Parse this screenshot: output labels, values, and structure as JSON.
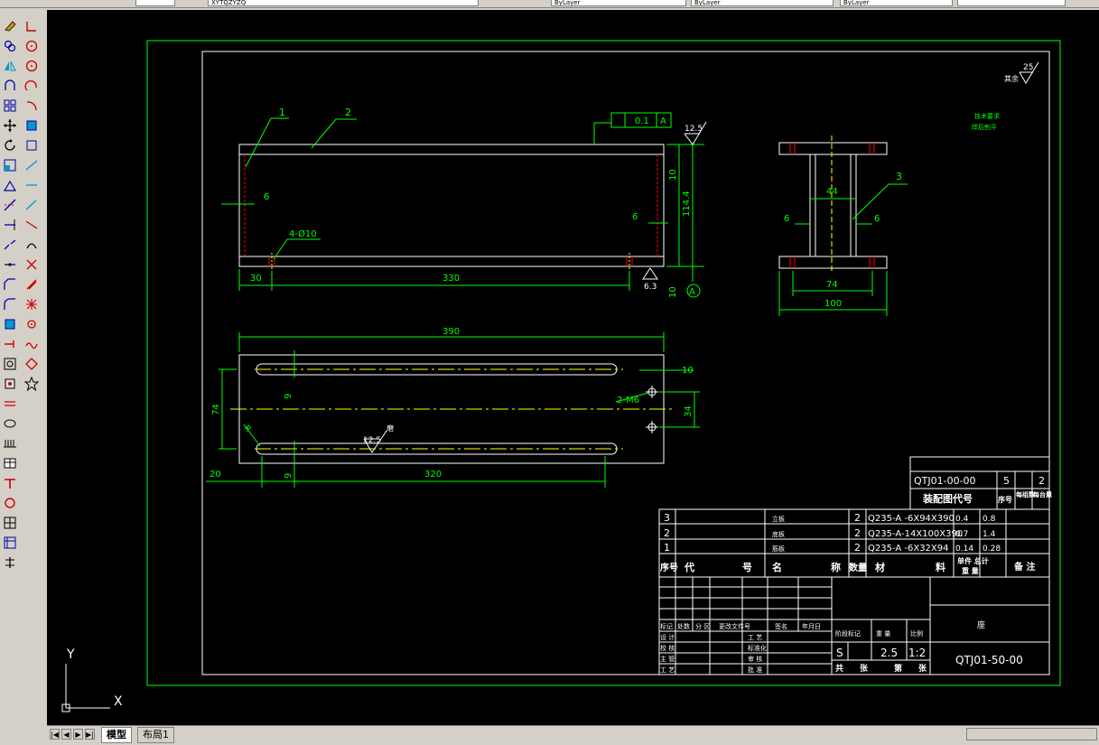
{
  "app": {
    "topbar": {
      "field1": "...",
      "field2": "XYTQZYZQ",
      "field3": "ByLayer",
      "field4": "ByLayer",
      "field5": "ByLayer"
    }
  },
  "tabs": [
    {
      "label": "模型"
    },
    {
      "label": "布局1"
    }
  ],
  "ucs": {
    "x_label": "X",
    "y_label": "Y"
  },
  "drawing": {
    "front_view": {
      "balloon_1": "1",
      "balloon_2": "2",
      "dim_6_left": "6",
      "dim_6_right": "6",
      "hole_note": "4-Ø10",
      "dim_30": "30",
      "dim_330": "330",
      "dim_10_top": "10",
      "dim_114": "114.4",
      "dim_10_bottom": "10",
      "tol_value": "0.1",
      "tol_datum": "A",
      "rough_top": "12.5",
      "rough_bottom": "6.3",
      "datum_label": "A"
    },
    "side_view": {
      "balloon_3": "3",
      "dim_44": "44",
      "dim_6_left": "6",
      "dim_6_right": "6",
      "dim_74": "74",
      "dim_100": "100"
    },
    "top_view": {
      "dim_390": "390",
      "dim_10": "10",
      "dim_74": "74",
      "thread_note": "2-M6",
      "dim_34": "34",
      "dim_9_top": "9",
      "dim_9_bottom": "9",
      "rough": "12.5",
      "rough_label": "磨",
      "radius_label": "R",
      "dim_20": "20",
      "dim_320": "320"
    },
    "notes": {
      "corner_rough": "25",
      "corner_rough_label": "其余",
      "tech_req_1": "技术要求",
      "tech_req_2": "焊后刨平"
    },
    "assembly_block": {
      "drawing_no": "QTJ01-00-00",
      "qty_a": "5",
      "qty_b": "2",
      "title": "装配图代号",
      "h_seq": "序号",
      "h_per": "每组数",
      "h_total": "每台量"
    },
    "bom": {
      "rows": [
        {
          "seq": "3",
          "code": "",
          "name": "立板",
          "qty": "2",
          "material": "Q235-A -6X94X390",
          "unit": "0.4",
          "total": "0.8",
          "note": ""
        },
        {
          "seq": "2",
          "code": "",
          "name": "底板",
          "qty": "2",
          "material": "Q235-A-14X100X390",
          "unit": "0.7",
          "total": "1.4",
          "note": ""
        },
        {
          "seq": "1",
          "code": "",
          "name": "筋板",
          "qty": "2",
          "material": "Q235-A -6X32X94",
          "unit": "0.14",
          "total": "0.28",
          "note": ""
        }
      ],
      "header": {
        "seq": "序号",
        "code": "代",
        "code2": "号",
        "name": "名",
        "name2": "称",
        "qty": "数量",
        "material": "材",
        "material2": "料",
        "weight_top": "单件 总计",
        "weight_bot": "重    量",
        "note": "备 注"
      }
    },
    "title_block": {
      "r1": "标记",
      "r2": "处数",
      "r3": "分 区",
      "r4": "更改文件号",
      "r5": "签名",
      "r6": "年月日",
      "design": "设 计",
      "check": "校 核",
      "main": "主 管",
      "craft": "工 艺",
      "std": "标准化",
      "approve": "批准",
      "review": "审 核",
      "craft2": "工 艺",
      "approve2": "批 准",
      "stage_label": "阶段标记",
      "weight_label": "重    量",
      "scale_label": "比例",
      "stage": "S",
      "weight": "2.5",
      "scale": "1:2",
      "sheet_total": "共",
      "sheet_label1": "张",
      "sheet_no": "第",
      "sheet_label2": "张",
      "part_name": "座",
      "drawing_no": "QTJ01-50-00"
    }
  }
}
